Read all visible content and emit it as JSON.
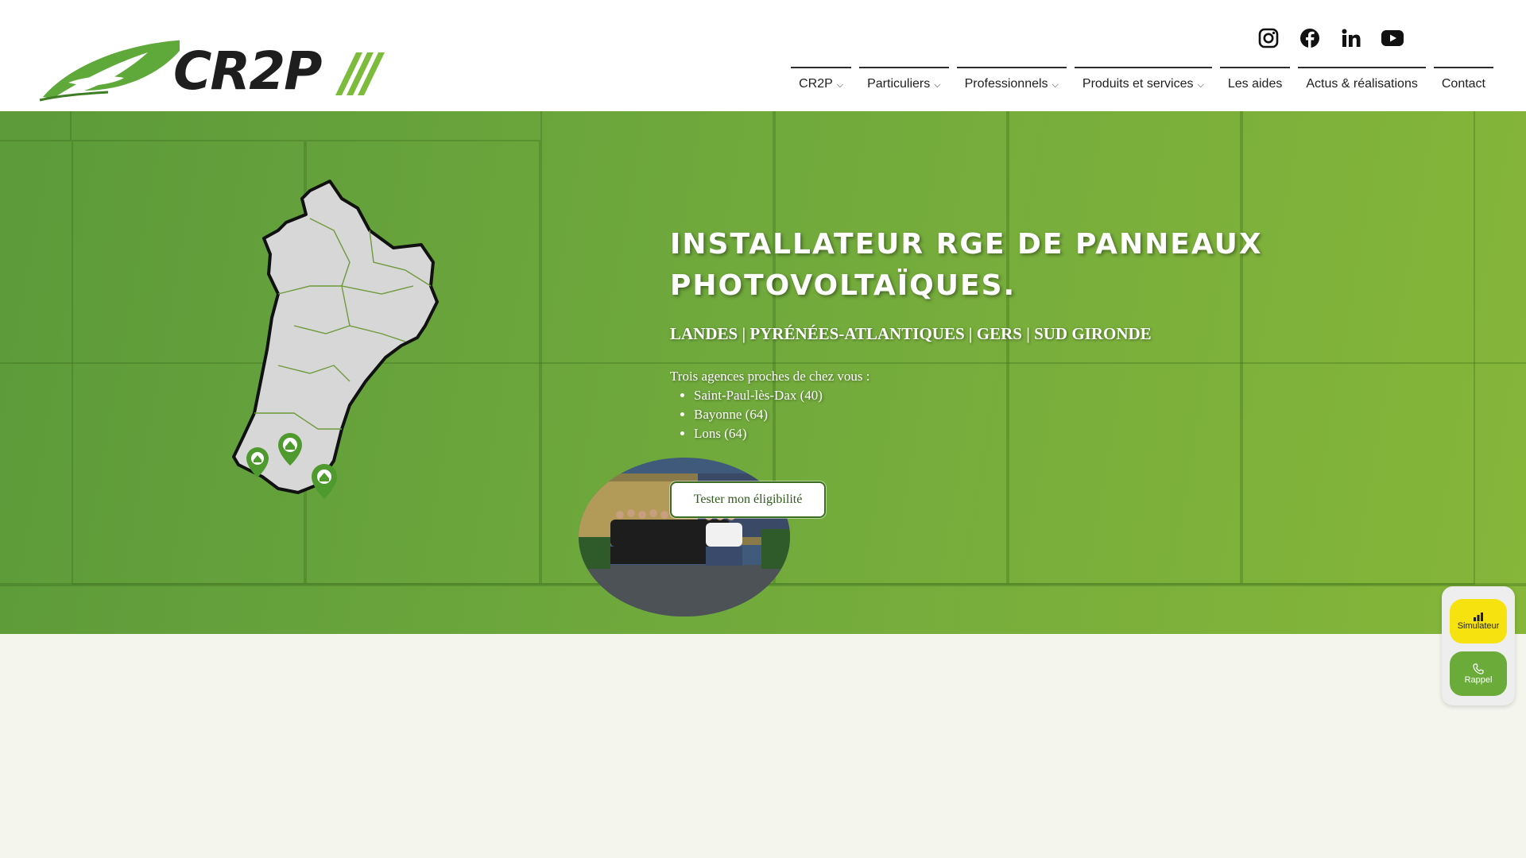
{
  "brand": {
    "name": "CR2P"
  },
  "social": [
    {
      "name": "instagram-icon"
    },
    {
      "name": "facebook-icon"
    },
    {
      "name": "linkedin-icon"
    },
    {
      "name": "youtube-icon"
    }
  ],
  "nav": [
    {
      "label": "CR2P",
      "dropdown": true
    },
    {
      "label": "Particuliers",
      "dropdown": true
    },
    {
      "label": "Professionnels",
      "dropdown": true
    },
    {
      "label": "Produits et services",
      "dropdown": true
    },
    {
      "label": "Les aides",
      "dropdown": false
    },
    {
      "label": "Actus & réalisations",
      "dropdown": false
    },
    {
      "label": "Contact",
      "dropdown": false
    }
  ],
  "hero": {
    "title_line1": "INSTALLATEUR RGE DE PANNEAUX",
    "title_line2": "PHOTOVOLTAÏQUES.",
    "subtitle": "LANDES | PYRÉNÉES-ATLANTIQUES | GERS | SUD GIRONDE",
    "intro": "Trois agences proches de chez vous :",
    "agencies": [
      "Saint-Paul-lès-Dax (40)",
      "Bayonne (64)",
      "Lons (64)"
    ],
    "cta": "Tester mon éligibilité"
  },
  "widget": {
    "simulator": "Simulateur",
    "callback": "Rappel"
  },
  "colors": {
    "brand_green": "#6aab3a",
    "dark": "#1e1e1e",
    "accent_yellow": "#f6e20f"
  }
}
